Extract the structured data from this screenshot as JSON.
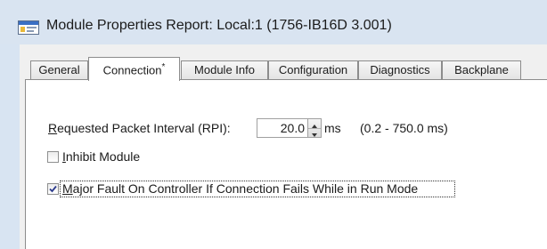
{
  "window": {
    "title": "Module Properties Report: Local:1 (1756-IB16D 3.001)"
  },
  "tabs": [
    {
      "label": "General",
      "active": false
    },
    {
      "label": "Connection",
      "marker": "*",
      "active": true
    },
    {
      "label": "Module Info",
      "active": false
    },
    {
      "label": "Configuration",
      "active": false
    },
    {
      "label": "Diagnostics",
      "active": false
    },
    {
      "label": "Backplane",
      "active": false
    }
  ],
  "connection": {
    "rpi_label_rest": "equested Packet Interval (RPI):",
    "rpi_label_mnemonic": "R",
    "rpi_value": "20.0",
    "rpi_unit": "ms",
    "rpi_range": "(0.2 - 750.0 ms)",
    "inhibit": {
      "mnemonic": "I",
      "label_rest": "nhibit Module",
      "checked": false
    },
    "major_fault": {
      "mnemonic": "M",
      "label_rest": "ajor Fault On Controller If Connection Fails While in Run Mode",
      "checked": true
    }
  },
  "colors": {
    "title_bg": "#d9e4f1",
    "dialog_bg": "#f0f0f0",
    "panel_bg": "#ffffff",
    "tab_border": "#8c8c8c",
    "checkmark": "#2b3a8c"
  },
  "icons": {
    "app": "window-app-icon",
    "spinner": "spin-updown-icon",
    "check": "checkmark-icon"
  }
}
